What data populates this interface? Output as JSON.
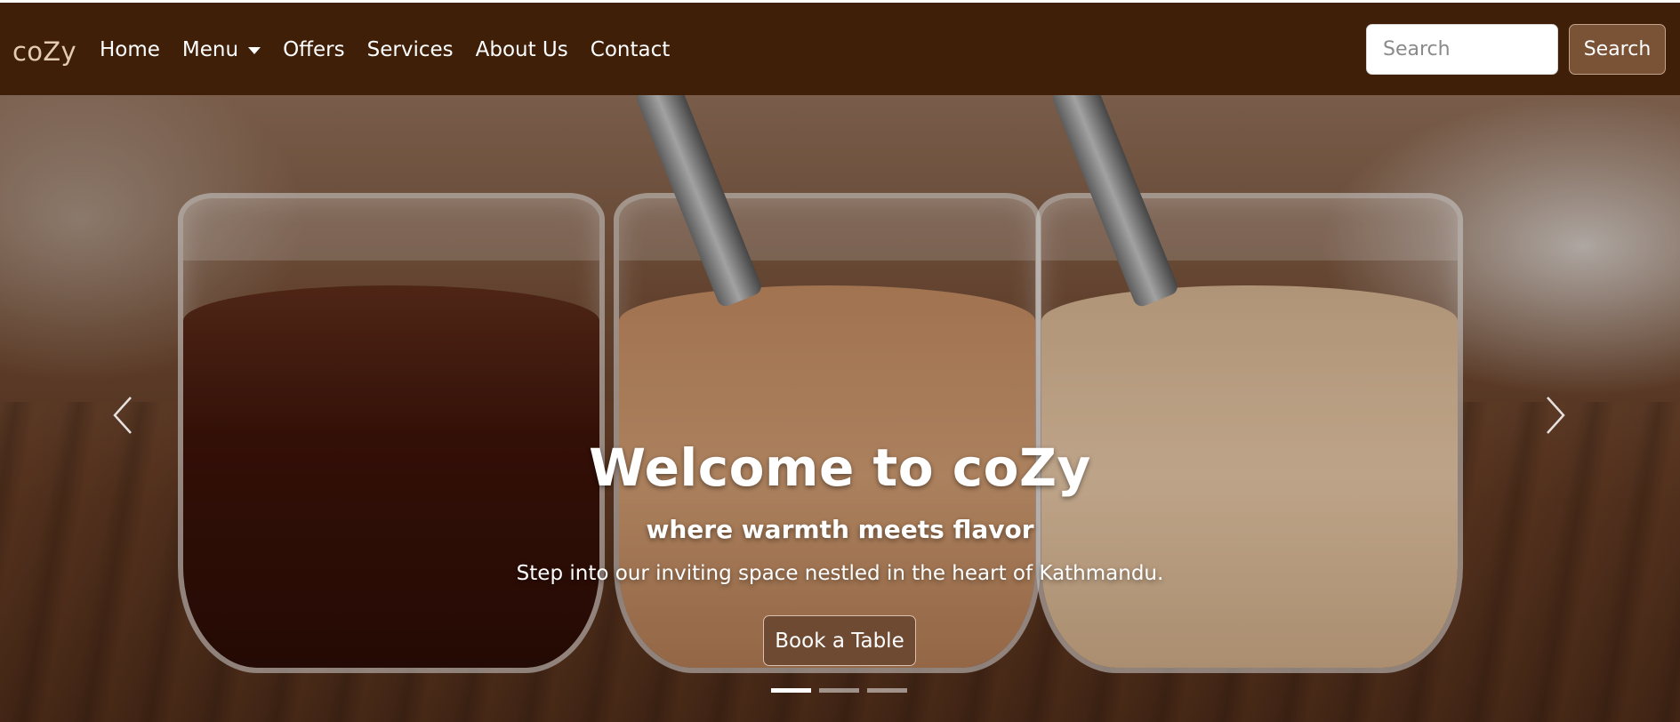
{
  "navbar": {
    "brand": "coZy",
    "links": [
      {
        "label": "Home"
      },
      {
        "label": "Menu",
        "dropdown": true
      },
      {
        "label": "Offers"
      },
      {
        "label": "Services"
      },
      {
        "label": "About Us"
      },
      {
        "label": "Contact"
      }
    ],
    "search": {
      "placeholder": "Search",
      "button_label": "Search"
    }
  },
  "hero": {
    "title": "Welcome to coZy",
    "subtitle": "where warmth meets flavor",
    "description": "Step into our inviting space nestled in the heart of Kathmandu.",
    "cta_label": "Book a Table",
    "prev_icon": "chevron-left-icon",
    "next_icon": "chevron-right-icon",
    "slides_count": 3,
    "active_slide": 1
  },
  "colors": {
    "navbar_bg": "#3f1f08",
    "brand": "#e3cbb4",
    "button_bg": "#7a5236",
    "cta_bg": "#6f4a33"
  }
}
